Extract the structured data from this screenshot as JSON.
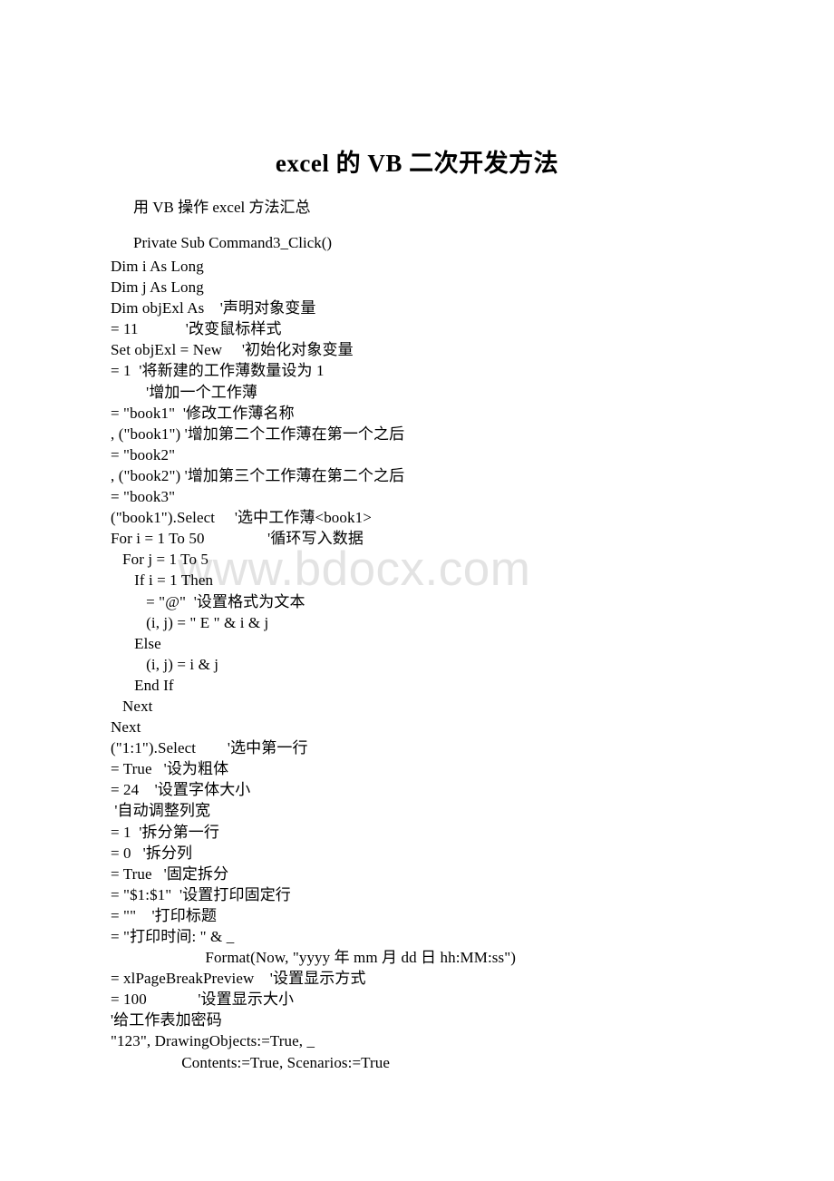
{
  "document": {
    "title": "excel 的 VB 二次开发方法",
    "watermark": "www.bdocx.com",
    "intro": [
      "用 VB 操作 excel 方法汇总",
      "Private Sub Command3_Click()"
    ],
    "code_lines": [
      "Dim i As Long",
      "Dim j As Long",
      "Dim objExl As    '声明对象变量",
      "= 11            '改变鼠标样式",
      "Set objExl = New     '初始化对象变量",
      "= 1  '将新建的工作薄数量设为 1",
      "         '增加一个工作薄",
      "= \"book1\"  '修改工作薄名称",
      ", (\"book1\") '增加第二个工作薄在第一个之后",
      "= \"book2\"",
      ", (\"book2\") '增加第三个工作薄在第二个之后",
      "= \"book3\"",
      "(\"book1\").Select     '选中工作薄<book1>",
      "For i = 1 To 50                '循环写入数据",
      "   For j = 1 To 5",
      "      If i = 1 Then",
      "         = \"@\"  '设置格式为文本",
      "         (i, j) = \" E \" & i & j",
      "      Else",
      "         (i, j) = i & j",
      "      End If",
      "   Next",
      "Next",
      "(\"1:1\").Select        '选中第一行",
      "= True   '设为粗体",
      "= 24    '设置字体大小",
      " '自动调整列宽",
      "= 1  '拆分第一行",
      "= 0   '拆分列",
      "= True   '固定拆分",
      "= \"$1:$1\"  '设置打印固定行",
      "= \"\"    '打印标题",
      "= \"打印时间: \" & _",
      "                        Format(Now, \"yyyy 年 mm 月 dd 日 hh:MM:ss\")",
      "= xlPageBreakPreview    '设置显示方式",
      "= 100             '设置显示大小",
      "'给工作表加密码",
      "\"123\", DrawingObjects:=True, _",
      "                  Contents:=True, Scenarios:=True"
    ]
  }
}
